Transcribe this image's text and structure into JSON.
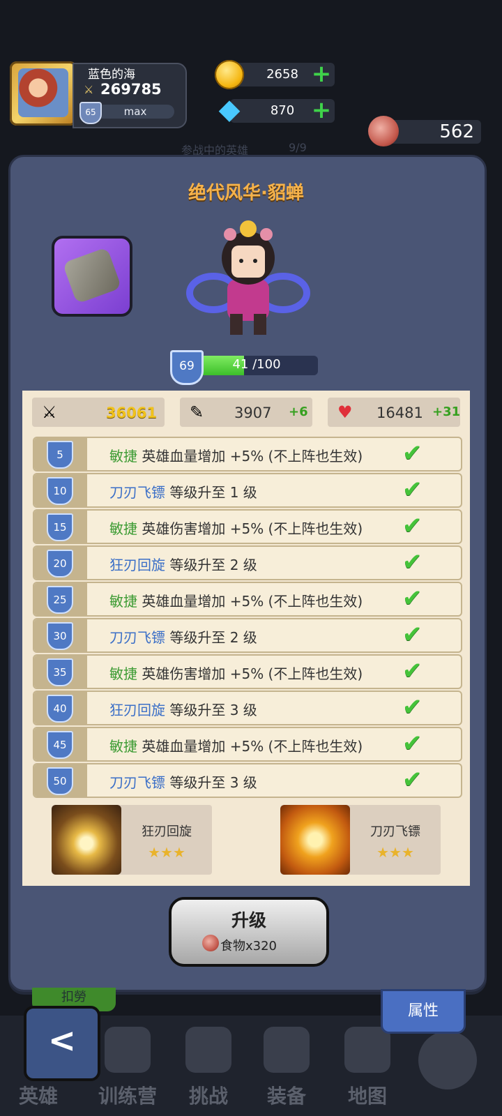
{
  "player": {
    "name": "蓝色的海",
    "power": "269785",
    "level": "65",
    "exp_label": "max"
  },
  "resources": {
    "gold": "2658",
    "gems": "870",
    "meat": "562"
  },
  "background": {
    "faded_label": "参战中的英雄",
    "faded_count": "9/9"
  },
  "hero": {
    "title": "绝代风华·貂蝉",
    "level": "69",
    "exp_text": "41 /100",
    "exp_fraction": 0.41
  },
  "stats": {
    "attack": "36061",
    "defense": "3907",
    "defense_bonus": "+6",
    "hp": "16481",
    "hp_bonus": "+31"
  },
  "milestones": [
    {
      "level": "5",
      "keyword": "敏捷",
      "kw_type": "green",
      "text": "英雄血量增加 +5% (不上阵也生效)"
    },
    {
      "level": "10",
      "keyword": "刀刃飞镖",
      "kw_type": "blue",
      "text": "等级升至 1 级"
    },
    {
      "level": "15",
      "keyword": "敏捷",
      "kw_type": "green",
      "text": "英雄伤害增加 +5% (不上阵也生效)"
    },
    {
      "level": "20",
      "keyword": "狂刃回旋",
      "kw_type": "blue",
      "text": "等级升至 2 级"
    },
    {
      "level": "25",
      "keyword": "敏捷",
      "kw_type": "green",
      "text": "英雄血量增加 +5% (不上阵也生效)"
    },
    {
      "level": "30",
      "keyword": "刀刃飞镖",
      "kw_type": "blue",
      "text": "等级升至 2 级"
    },
    {
      "level": "35",
      "keyword": "敏捷",
      "kw_type": "green",
      "text": "英雄伤害增加 +5% (不上阵也生效)"
    },
    {
      "level": "40",
      "keyword": "狂刃回旋",
      "kw_type": "blue",
      "text": "等级升至 3 级"
    },
    {
      "level": "45",
      "keyword": "敏捷",
      "kw_type": "green",
      "text": "英雄血量增加 +5% (不上阵也生效)"
    },
    {
      "level": "50",
      "keyword": "刀刃飞镖",
      "kw_type": "blue",
      "text": "等级升至 3 级"
    }
  ],
  "skills": [
    {
      "name": "狂刃回旋",
      "stars": "★★★"
    },
    {
      "name": "刀刃飞镖",
      "stars": "★★★"
    }
  ],
  "upgrade": {
    "label": "升级",
    "cost": "食物x320"
  },
  "buttons": {
    "attributes": "属性",
    "back": "<",
    "green_tab": "扣勞"
  },
  "nav": [
    {
      "label": "英雄"
    },
    {
      "label": "训练营"
    },
    {
      "label": "挑战"
    },
    {
      "label": "装备"
    },
    {
      "label": "地图"
    }
  ],
  "colors": {
    "keyword_green": "#3c9b33",
    "keyword_blue": "#3b6fc7",
    "check": "#45c33a",
    "title": "#f6b24a"
  }
}
